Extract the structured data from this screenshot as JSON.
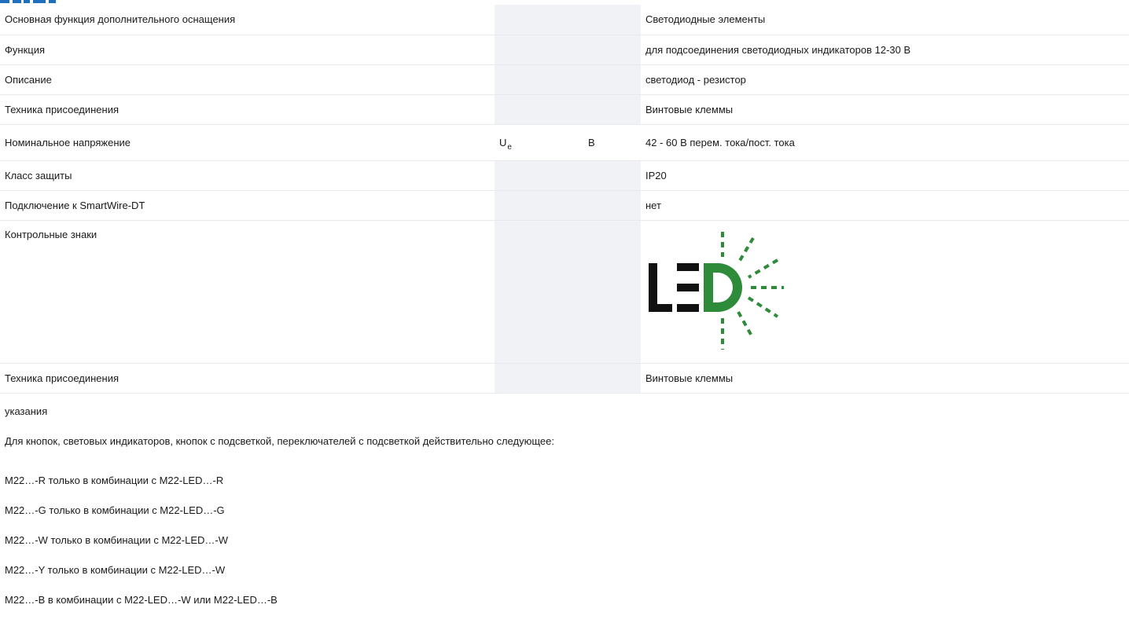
{
  "header": {
    "accent_color": "#1f6fbd"
  },
  "table": {
    "rows": [
      {
        "label": "Основная функция дополнительного оснащения",
        "symbol": "",
        "unit": "",
        "value": "Светодиодные элементы"
      },
      {
        "label": "Функция",
        "symbol": "",
        "unit": "",
        "value": "для подсоединения светодиодных индикаторов 12-30 В"
      },
      {
        "label": "Описание",
        "symbol": "",
        "unit": "",
        "value": "светодиод - резистор"
      },
      {
        "label": "Техника присоединения",
        "symbol": "",
        "unit": "",
        "value": "Винтовые клеммы"
      },
      {
        "label": "Номинальное напряжение",
        "symbol": "U",
        "symbol_sub": "e",
        "unit": "В",
        "value": "42 - 60 В перем. тока/пост. тока"
      },
      {
        "label": "Класс защиты",
        "symbol": "",
        "unit": "",
        "value": "IP20"
      },
      {
        "label": "Подключение к SmartWire-DT",
        "symbol": "",
        "unit": "",
        "value": "нет"
      },
      {
        "label": "Контрольные знаки",
        "symbol": "",
        "unit": "",
        "value": ""
      },
      {
        "label": "Техника присоединения",
        "symbol": "",
        "unit": "",
        "value": "Винтовые клеммы"
      }
    ]
  },
  "led_logo": {
    "icon": "led-logo",
    "letters": "LED",
    "text_color": "#111111",
    "accent_color": "#2e8b3a"
  },
  "notes": {
    "title": "указания",
    "intro": "Для кнопок, световых индикаторов, кнопок с подсветкой, переключателей с подсветкой действительно следующее:",
    "items": [
      "M22…-R только в комбинации с M22-LED…-R",
      "M22…-G только в комбинации с M22-LED…-G",
      "M22…-W только в комбинации с M22-LED…-W",
      "M22…-Y только в комбинации с M22-LED…-W",
      "M22…-B в комбинации с M22-LED…-W или M22-LED…-B"
    ]
  }
}
